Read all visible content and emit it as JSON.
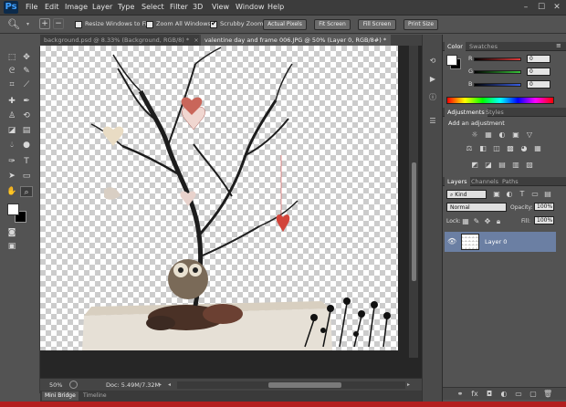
{
  "app": {
    "logo": "Ps"
  },
  "menu": [
    "File",
    "Edit",
    "Image",
    "Layer",
    "Type",
    "Select",
    "Filter",
    "3D",
    "View",
    "Window",
    "Help"
  ],
  "window_controls": [
    "–",
    "☐",
    "✕"
  ],
  "options_bar": {
    "resize_windows": "Resize Windows to Fit",
    "zoom_all": "Zoom All Windows",
    "scrubby_zoom": "Scrubby Zoom",
    "actual_pixels": "Actual Pixels",
    "fit_screen": "Fit Screen",
    "fill_screen": "Fill Screen",
    "print_size": "Print Size",
    "scrubby_checked": true,
    "resize_checked": false,
    "zoom_all_checked": false
  },
  "doc_tabs": [
    {
      "label": "background.psd @ 8.33% (Background, RGB/8) *",
      "close": "×",
      "active": false
    },
    {
      "label": "valentine day and frame 006.JPG @ 50% (Layer 0, RGB/8#) *",
      "close": "×",
      "active": true
    }
  ],
  "status": {
    "zoom": "50%",
    "doc": "Doc: 5.49M/7.32M"
  },
  "bottom_tabs": [
    "Mini Bridge",
    "Timeline"
  ],
  "color_panel": {
    "tabs": [
      "Color",
      "Swatches"
    ],
    "channels": [
      {
        "label": "R",
        "value": "0",
        "color": "#e23b3b"
      },
      {
        "label": "G",
        "value": "0",
        "color": "#38c23a"
      },
      {
        "label": "B",
        "value": "0",
        "color": "#3a5ee2"
      }
    ]
  },
  "adjustments_panel": {
    "tabs": [
      "Adjustments",
      "Styles"
    ],
    "heading": "Add an adjustment",
    "icon_rows": [
      [
        "☼",
        "▦",
        "◐",
        "▣",
        "▽"
      ],
      [
        "⚖",
        "◧",
        "◫",
        "▩",
        "◕",
        "▦"
      ],
      [
        "◩",
        "◪",
        "▤",
        "▥",
        "▧"
      ]
    ]
  },
  "layers_panel": {
    "tabs": [
      "Layers",
      "Channels",
      "Paths"
    ],
    "kind": "Kind",
    "blend_mode": "Normal",
    "opacity_label": "Opacity:",
    "opacity_value": "100%",
    "lock_label": "Lock:",
    "fill_label": "Fill:",
    "fill_value": "100%",
    "layers": [
      {
        "name": "Layer 0",
        "visible": true
      }
    ],
    "footer_icons": [
      "⚭",
      "fx",
      "◘",
      "◐",
      "▭",
      "▢",
      "🗑"
    ]
  },
  "accent": {
    "selection": "#6b7fa3",
    "taskbar": "#b21f1f"
  }
}
